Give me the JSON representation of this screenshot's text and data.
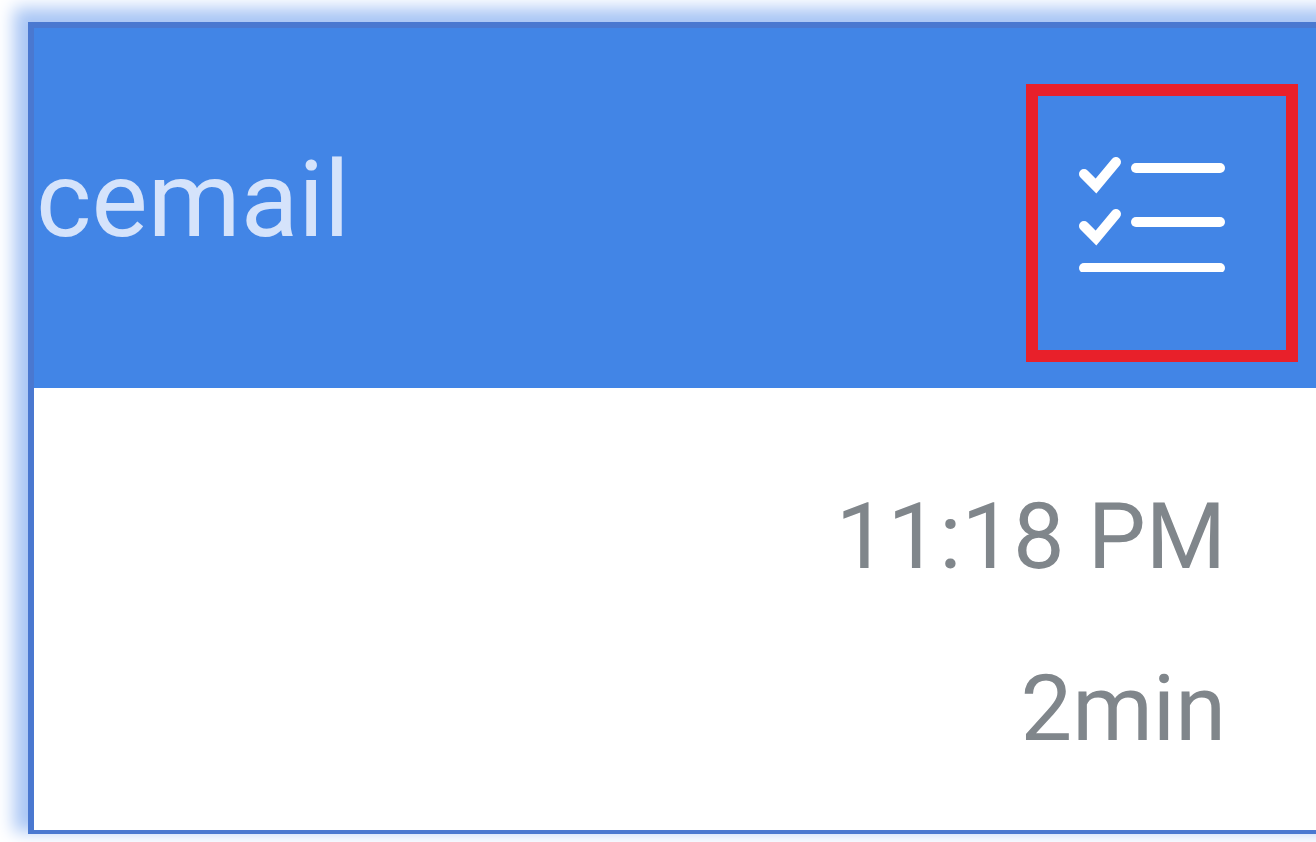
{
  "header": {
    "title": "cemail",
    "action": {
      "highlighted": true
    }
  },
  "entry": {
    "time": "11:18 PM",
    "duration": "2min"
  }
}
